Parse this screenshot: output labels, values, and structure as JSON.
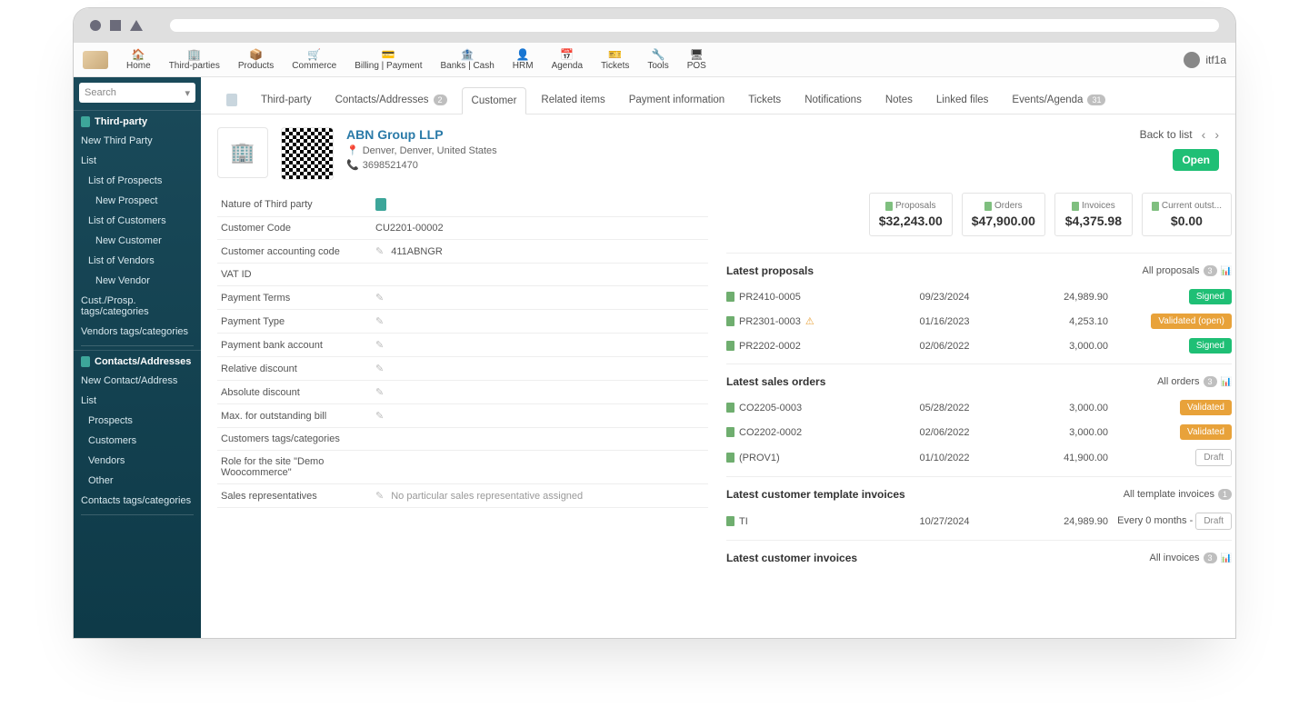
{
  "user": "itf1a",
  "nav": [
    {
      "icon": "🏠",
      "label": "Home"
    },
    {
      "icon": "🏢",
      "label": "Third-parties"
    },
    {
      "icon": "📦",
      "label": "Products"
    },
    {
      "icon": "🛒",
      "label": "Commerce"
    },
    {
      "icon": "💳",
      "label": "Billing | Payment"
    },
    {
      "icon": "🏦",
      "label": "Banks | Cash"
    },
    {
      "icon": "👤",
      "label": "HRM"
    },
    {
      "icon": "📅",
      "label": "Agenda"
    },
    {
      "icon": "🎫",
      "label": "Tickets"
    },
    {
      "icon": "🔧",
      "label": "Tools"
    },
    {
      "icon": "🖥",
      "label": "POS"
    }
  ],
  "search_placeholder": "Search",
  "sidebar": {
    "group1_title": "Third-party",
    "g1": [
      "New Third Party",
      "List",
      "List of Prospects",
      "New Prospect",
      "List of Customers",
      "New Customer",
      "List of Vendors",
      "New Vendor",
      "Cust./Prosp. tags/categories",
      "Vendors tags/categories"
    ],
    "group2_title": "Contacts/Addresses",
    "g2": [
      "New Contact/Address",
      "List",
      "Prospects",
      "Customers",
      "Vendors",
      "Other",
      "Contacts tags/categories"
    ]
  },
  "tabs": {
    "third_party": "Third-party",
    "contacts": "Contacts/Addresses",
    "contacts_badge": "2",
    "customer": "Customer",
    "related": "Related items",
    "payment": "Payment information",
    "tickets": "Tickets",
    "notifications": "Notifications",
    "notes": "Notes",
    "linked": "Linked files",
    "events": "Events/Agenda",
    "events_badge": "31"
  },
  "header": {
    "title": "ABN Group LLP",
    "address": "Denver, Denver, United States",
    "phone": "3698521470",
    "back": "Back to list",
    "status": "Open"
  },
  "details": {
    "nature": "Nature of Third party",
    "customer_code_lbl": "Customer Code",
    "customer_code": "CU2201-00002",
    "acc_code_lbl": "Customer accounting code",
    "acc_code": "411ABNGR",
    "vat": "VAT ID",
    "pterms": "Payment Terms",
    "ptype": "Payment Type",
    "pbank": "Payment bank account",
    "reldisc": "Relative discount",
    "absdisc": "Absolute discount",
    "maxbill": "Max. for outstanding bill",
    "tags": "Customers tags/categories",
    "role": "Role for the site \"Demo Woocommerce\"",
    "salesrep_lbl": "Sales representatives",
    "salesrep": "No particular sales representative assigned"
  },
  "summary": {
    "proposals_lbl": "Proposals",
    "proposals": "$32,243.00",
    "orders_lbl": "Orders",
    "orders": "$47,900.00",
    "invoices_lbl": "Invoices",
    "invoices": "$4,375.98",
    "outst_lbl": "Current outst...",
    "outst": "$0.00"
  },
  "panels": {
    "proposals": {
      "title": "Latest proposals",
      "all": "All proposals",
      "badge": "3",
      "rows": [
        {
          "ref": "PR2410-0005",
          "date": "09/23/2024",
          "amt": "24,989.90",
          "status": "Signed",
          "cls": "green"
        },
        {
          "ref": "PR2301-0003",
          "date": "01/16/2023",
          "amt": "4,253.10",
          "status": "Validated (open)",
          "cls": "orange",
          "warn": true
        },
        {
          "ref": "PR2202-0002",
          "date": "02/06/2022",
          "amt": "3,000.00",
          "status": "Signed",
          "cls": "green"
        }
      ]
    },
    "orders": {
      "title": "Latest sales orders",
      "all": "All orders",
      "badge": "3",
      "rows": [
        {
          "ref": "CO2205-0003",
          "date": "05/28/2022",
          "amt": "3,000.00",
          "status": "Validated",
          "cls": "orange"
        },
        {
          "ref": "CO2202-0002",
          "date": "02/06/2022",
          "amt": "3,000.00",
          "status": "Validated",
          "cls": "orange"
        },
        {
          "ref": "(PROV1)",
          "date": "01/10/2022",
          "amt": "41,900.00",
          "status": "Draft",
          "cls": "grey"
        }
      ]
    },
    "tinvoices": {
      "title": "Latest customer template invoices",
      "all": "All template invoices",
      "badge": "1",
      "rows": [
        {
          "ref": "TI",
          "date": "10/27/2024",
          "amt": "24,989.90",
          "prefix": "Every 0 months -",
          "status": "Draft",
          "cls": "grey"
        }
      ]
    },
    "cinvoices": {
      "title": "Latest customer invoices",
      "all": "All invoices",
      "badge": "3"
    }
  }
}
